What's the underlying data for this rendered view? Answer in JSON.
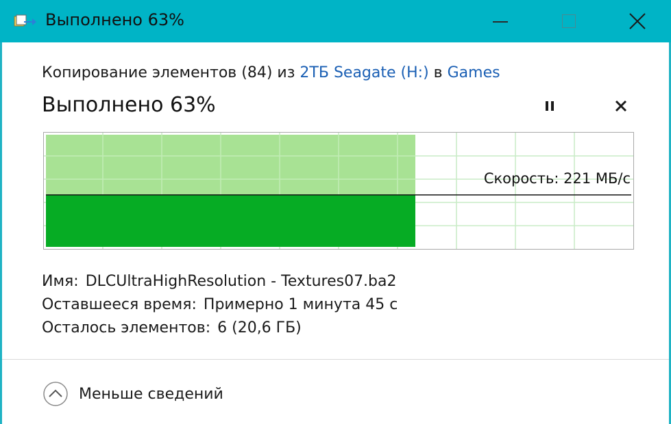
{
  "window": {
    "title": "Выполнено 63%",
    "accent_color": "#00b4c6"
  },
  "copy_info": {
    "prefix": "Копирование элементов (84) из",
    "source": "2ТБ Seagate  (H:)",
    "middle": "в",
    "destination": "Games"
  },
  "progress": {
    "heading": "Выполнено 63%",
    "percent": 63,
    "speed_label": "Скорость: 221 МБ/с",
    "fill_color": "#06ac24",
    "history_color": "#a8e294"
  },
  "details": {
    "name_label": "Имя:",
    "name_value": "DLCUltraHighResolution - Textures07.ba2",
    "time_label": "Оставшееся время:",
    "time_value": "Примерно 1 минута 45 с",
    "items_label": "Осталось элементов:",
    "items_value": "6 (20,6 ГБ)"
  },
  "footer": {
    "less_details_label": "Меньше сведений"
  },
  "icons": {
    "app": "copy-transfer-icon",
    "pause": "pause-icon",
    "cancel": "cancel-icon",
    "minimize": "minimize-icon",
    "maximize": "maximize-icon",
    "close": "close-icon",
    "collapse": "chevron-up-circle-icon"
  }
}
